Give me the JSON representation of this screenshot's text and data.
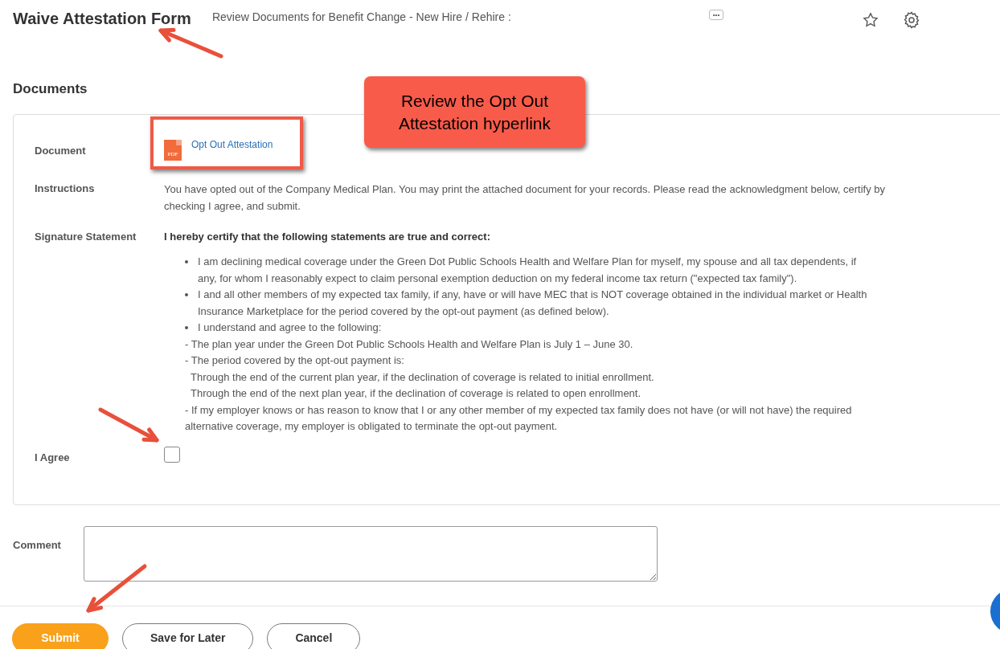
{
  "header": {
    "title": "Waive Attestation Form",
    "subtitle": "Review Documents for Benefit Change - New Hire / Rehire :",
    "more_label": "•••"
  },
  "section_title": "Documents",
  "callout": {
    "text": "Review the Opt Out Attestation hyperlink"
  },
  "document": {
    "label": "Document",
    "file_type": "PDF",
    "link": "Opt Out Attestation"
  },
  "instructions": {
    "label": "Instructions",
    "lines": [
      "You have opted out of the Company Medical Plan. You may print the attached document for your records. Please read the acknowledgment below, certify by",
      "checking I agree, and submit."
    ]
  },
  "signature": {
    "label": "Signature Statement",
    "heading": "I hereby certify that the following statements are true and correct:",
    "bullets": [
      {
        "lines": [
          "I am declining medical coverage under the Green Dot Public Schools Health and Welfare Plan for myself, my spouse and all tax dependents, if",
          "any, for whom I reasonably expect to claim personal exemption deduction on my federal income tax return (\"expected tax family\")."
        ]
      },
      {
        "lines": [
          "I and all other members of my expected tax family, if any, have or will have MEC that is NOT coverage obtained in the individual market or Health",
          "Insurance Marketplace for the period covered by the opt-out payment (as defined below)."
        ]
      },
      {
        "lines": [
          "I understand and agree to the following:"
        ],
        "sub": [
          "- The plan year under the Green Dot Public Schools Health and Welfare Plan is July 1 – June 30.",
          "- The period covered by the opt-out payment is:",
          "  Through the end of the current plan year, if the declination of coverage is related to initial enrollment.",
          "  Through the end of the next plan year, if the declination of coverage is related to open enrollment.",
          "- If my employer knows or has reason to know that I or any other member of my expected tax family does not have (or will not have) the required",
          "alternative coverage, my employer is obligated to terminate the opt-out payment."
        ]
      }
    ]
  },
  "agree": {
    "label": "I Agree",
    "checked": false
  },
  "comment": {
    "label": "Comment"
  },
  "buttons": [
    {
      "label": "Submit",
      "kind": "primary"
    },
    {
      "label": "Save for Later",
      "kind": "secondary"
    },
    {
      "label": "Cancel",
      "kind": "secondary"
    }
  ]
}
